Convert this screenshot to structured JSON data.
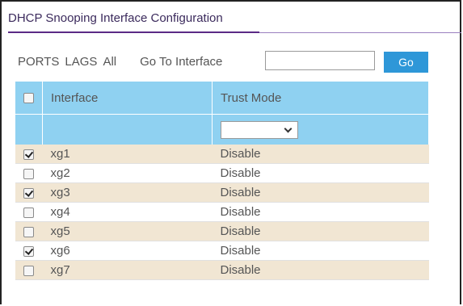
{
  "page": {
    "title": "DHCP Snooping Interface Configuration"
  },
  "toolbar": {
    "ports_label": "PORTS",
    "lags_label": "LAGS",
    "all_label": "All",
    "goto_label": "Go To Interface",
    "goto_value": "",
    "go_button": "Go"
  },
  "table": {
    "headers": {
      "interface": "Interface",
      "trust_mode": "Trust Mode"
    },
    "filter": {
      "trust_mode_selected": ""
    },
    "rows": [
      {
        "interface": "xg1",
        "trust_mode": "Disable",
        "checked": true
      },
      {
        "interface": "xg2",
        "trust_mode": "Disable",
        "checked": false
      },
      {
        "interface": "xg3",
        "trust_mode": "Disable",
        "checked": true
      },
      {
        "interface": "xg4",
        "trust_mode": "Disable",
        "checked": false
      },
      {
        "interface": "xg5",
        "trust_mode": "Disable",
        "checked": false
      },
      {
        "interface": "xg6",
        "trust_mode": "Disable",
        "checked": true
      },
      {
        "interface": "xg7",
        "trust_mode": "Disable",
        "checked": false
      }
    ]
  },
  "colors": {
    "header_bg": "#8fd1f1",
    "odd_row_bg": "#f1e6d3",
    "go_button_bg": "#2e97d8",
    "title_underline": "#5b2a86"
  }
}
